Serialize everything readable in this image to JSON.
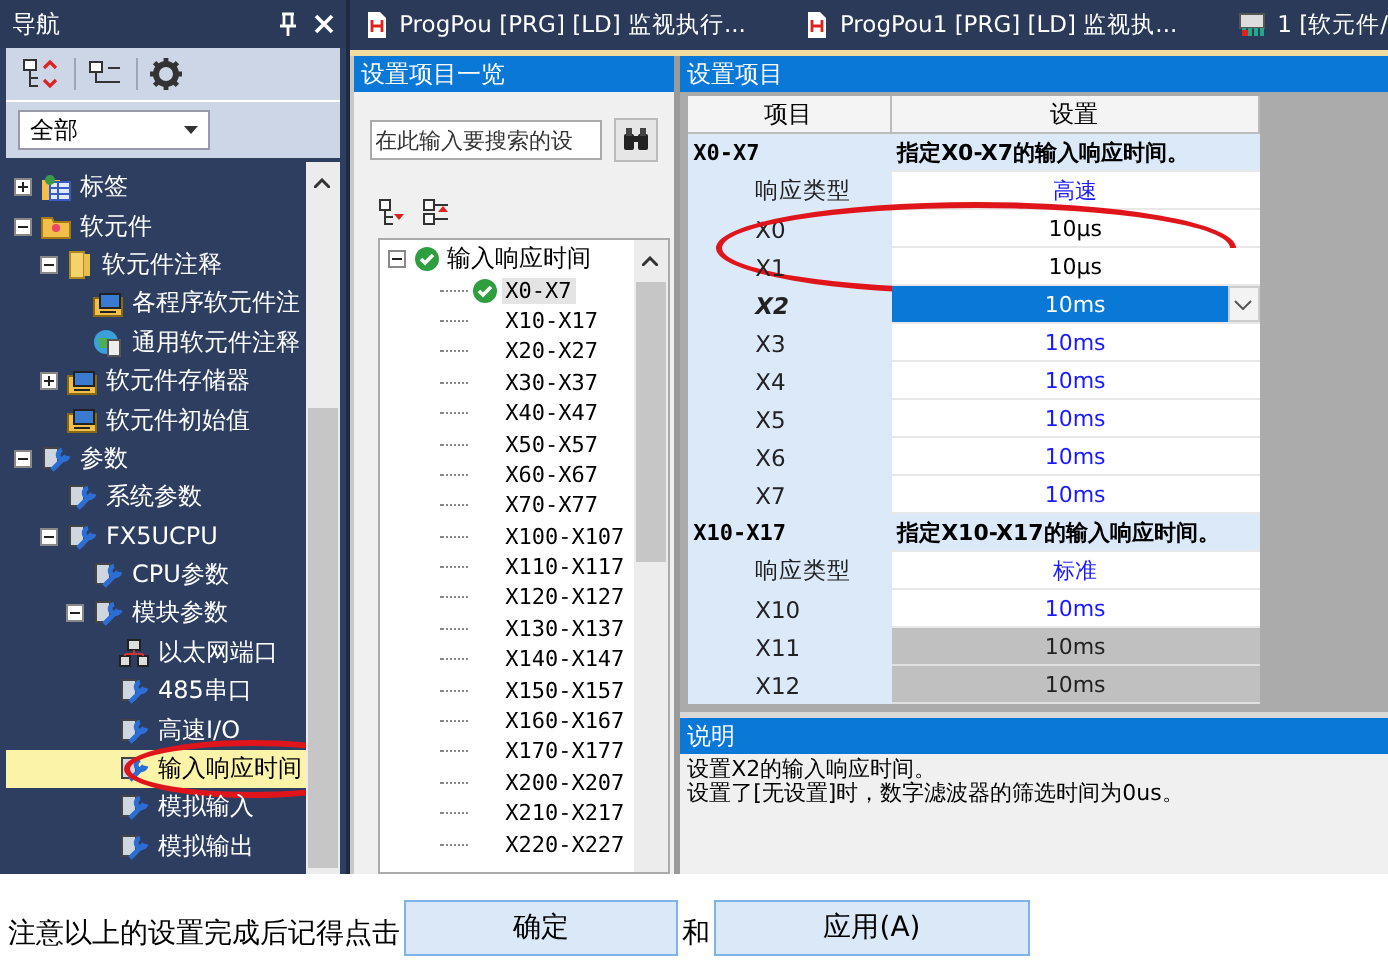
{
  "nav": {
    "title": "导航",
    "filter": "全部",
    "tree": [
      {
        "label": "标签",
        "kind": "table",
        "expanded": false,
        "selected": false
      },
      {
        "label": "软元件",
        "kind": "folder",
        "expanded": true,
        "selected": false,
        "children": [
          {
            "label": "软元件注释",
            "kind": "book",
            "expanded": true,
            "selected": false,
            "children": [
              {
                "label": "各程序软元件注",
                "kind": "monitor",
                "selected": false
              },
              {
                "label": "通用软元件注释",
                "kind": "globe",
                "selected": false
              }
            ]
          },
          {
            "label": "软元件存储器",
            "kind": "monitor",
            "expanded": false,
            "selected": false
          },
          {
            "label": "软元件初始值",
            "kind": "monitor",
            "selected": false
          }
        ]
      },
      {
        "label": "参数",
        "kind": "param",
        "expanded": true,
        "selected": false,
        "children": [
          {
            "label": "系统参数",
            "kind": "param",
            "selected": false
          },
          {
            "label": "FX5UCPU",
            "kind": "param",
            "expanded": true,
            "selected": false,
            "children": [
              {
                "label": "CPU参数",
                "kind": "param",
                "selected": false
              },
              {
                "label": "模块参数",
                "kind": "param",
                "expanded": true,
                "selected": false,
                "children": [
                  {
                    "label": "以太网端口",
                    "kind": "network",
                    "selected": false
                  },
                  {
                    "label": "485串口",
                    "kind": "param",
                    "selected": false
                  },
                  {
                    "label": "高速I/O",
                    "kind": "param",
                    "selected": false
                  },
                  {
                    "label": "输入响应时间",
                    "kind": "param",
                    "selected": true,
                    "circled": true
                  },
                  {
                    "label": "模拟输入",
                    "kind": "param",
                    "selected": false
                  },
                  {
                    "label": "模拟输出",
                    "kind": "param",
                    "selected": false
                  }
                ]
              }
            ]
          }
        ]
      }
    ]
  },
  "tabs": [
    {
      "label": "ProgPou [PRG] [LD] 监视执行...",
      "kind": "ladder",
      "selected": false
    },
    {
      "label": "ProgPou1 [PRG] [LD] 监视执...",
      "kind": "ladder",
      "selected": false
    },
    {
      "label": "1 [软元件/",
      "kind": "device",
      "selected": false
    }
  ],
  "item_list": {
    "title": "设置项目一览",
    "search": {
      "placeholder": "在此输入要搜索的设"
    },
    "tree": [
      {
        "label": "输入响应时间",
        "checked": true,
        "expanded": true,
        "selected": false,
        "children": [
          {
            "label": "X0-X7",
            "checked": true,
            "selected": true
          },
          {
            "label": "X10-X17",
            "checked": false,
            "selected": false
          },
          {
            "label": "X20-X27",
            "checked": false,
            "selected": false
          },
          {
            "label": "X30-X37",
            "checked": false,
            "selected": false
          },
          {
            "label": "X40-X47",
            "checked": false,
            "selected": false
          },
          {
            "label": "X50-X57",
            "checked": false,
            "selected": false
          },
          {
            "label": "X60-X67",
            "checked": false,
            "selected": false
          },
          {
            "label": "X70-X77",
            "checked": false,
            "selected": false
          },
          {
            "label": "X100-X107",
            "checked": false,
            "selected": false
          },
          {
            "label": "X110-X117",
            "checked": false,
            "selected": false
          },
          {
            "label": "X120-X127",
            "checked": false,
            "selected": false
          },
          {
            "label": "X130-X137",
            "checked": false,
            "selected": false
          },
          {
            "label": "X140-X147",
            "checked": false,
            "selected": false
          },
          {
            "label": "X150-X157",
            "checked": false,
            "selected": false
          },
          {
            "label": "X160-X167",
            "checked": false,
            "selected": false
          },
          {
            "label": "X170-X177",
            "checked": false,
            "selected": false
          },
          {
            "label": "X200-X207",
            "checked": false,
            "selected": false
          },
          {
            "label": "X210-X217",
            "checked": false,
            "selected": false
          },
          {
            "label": "X220-X227",
            "checked": false,
            "selected": false
          }
        ]
      }
    ]
  },
  "settings": {
    "title": "设置项目",
    "columns": [
      "项目",
      "设置"
    ],
    "rows": [
      {
        "kind": "group",
        "item": "X0-X7",
        "value": "指定X0-X7的输入响应时间。"
      },
      {
        "kind": "setting",
        "item": "响应类型",
        "value": "高速",
        "changed": false,
        "disabled": false,
        "selected": false
      },
      {
        "kind": "setting",
        "item": "X0",
        "value": "10μs",
        "changed": true,
        "disabled": false,
        "selected": false,
        "circled": true
      },
      {
        "kind": "setting",
        "item": "X1",
        "value": "10μs",
        "changed": true,
        "disabled": false,
        "selected": false,
        "circled": true
      },
      {
        "kind": "setting",
        "item": "X2",
        "value": "10ms",
        "changed": false,
        "disabled": false,
        "selected": true
      },
      {
        "kind": "setting",
        "item": "X3",
        "value": "10ms",
        "changed": false,
        "disabled": false,
        "selected": false
      },
      {
        "kind": "setting",
        "item": "X4",
        "value": "10ms",
        "changed": false,
        "disabled": false,
        "selected": false
      },
      {
        "kind": "setting",
        "item": "X5",
        "value": "10ms",
        "changed": false,
        "disabled": false,
        "selected": false
      },
      {
        "kind": "setting",
        "item": "X6",
        "value": "10ms",
        "changed": false,
        "disabled": false,
        "selected": false
      },
      {
        "kind": "setting",
        "item": "X7",
        "value": "10ms",
        "changed": false,
        "disabled": false,
        "selected": false
      },
      {
        "kind": "group",
        "item": "X10-X17",
        "value": "指定X10-X17的输入响应时间。"
      },
      {
        "kind": "setting",
        "item": "响应类型",
        "value": "标准",
        "changed": false,
        "disabled": false,
        "selected": false
      },
      {
        "kind": "setting",
        "item": "X10",
        "value": "10ms",
        "changed": false,
        "disabled": false,
        "selected": false
      },
      {
        "kind": "setting",
        "item": "X11",
        "value": "10ms",
        "changed": false,
        "disabled": true,
        "selected": false
      },
      {
        "kind": "setting",
        "item": "X12",
        "value": "10ms",
        "changed": false,
        "disabled": true,
        "selected": false
      }
    ]
  },
  "description": {
    "title": "说明",
    "lines": [
      "设置X2的输入响应时间。",
      "设置了[无设置]时，数字滤波器的筛选时间为0us。"
    ]
  },
  "footer": {
    "note": "注意以上的设置完成后记得点击",
    "buttons": [
      "确定",
      "应用(A)"
    ],
    "joiner": "和"
  }
}
